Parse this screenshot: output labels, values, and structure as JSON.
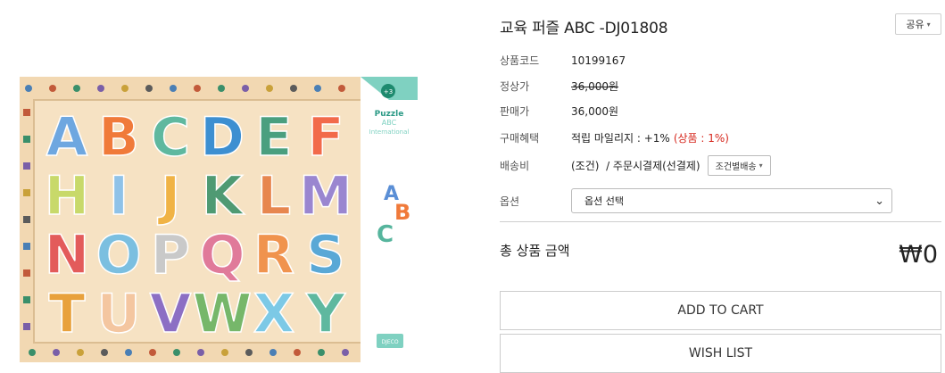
{
  "product": {
    "title": "교육 퍼즐 ABC -DJ01808",
    "share_label": "공유",
    "image_alt": "Djeco Puzzle ABC International",
    "box_text": {
      "age": "+3",
      "line1": "Puzzle",
      "line2": "ABC",
      "line3": "International",
      "brand": "DJECO"
    },
    "letters": [
      "A",
      "B",
      "C",
      "D",
      "E",
      "F",
      "H",
      "I",
      "J",
      "K",
      "L",
      "M",
      "N",
      "O",
      "P",
      "Q",
      "R",
      "S",
      "T",
      "U",
      "V",
      "W",
      "X",
      "Y"
    ]
  },
  "info": {
    "code_label": "상품코드",
    "code_value": "10199167",
    "list_price_label": "정상가",
    "list_price_value": "36,000원",
    "sale_price_label": "판매가",
    "sale_price_value": "36,000원",
    "benefit_label": "구매혜택",
    "benefit_value": "적립 마일리지 : +1%",
    "benefit_extra": "(상품 : 1%)",
    "shipping_label": "배송비",
    "shipping_value": "(조건)  / 주문시결제(선결제)",
    "shipping_select": "조건별배송"
  },
  "options": {
    "label": "옵션",
    "placeholder": "옵션 선택"
  },
  "total": {
    "label": "총 상품 금액",
    "value": "₩0"
  },
  "actions": {
    "add_to_cart": "ADD TO CART",
    "wish_list": "WISH LIST"
  },
  "colors": {
    "board": "#f2d8b2",
    "box_teal": "#7fd1c1",
    "red_text": "#d6281e"
  }
}
